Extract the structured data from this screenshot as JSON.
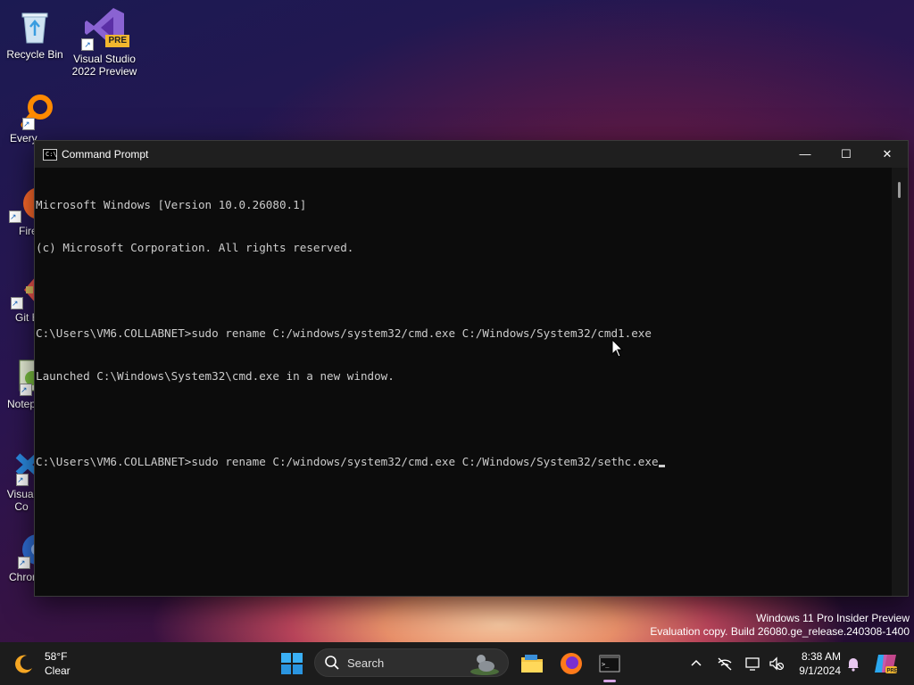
{
  "desktop": {
    "icons": [
      {
        "label": "Recycle Bin"
      },
      {
        "label": "Visual Studio\n2022 Preview",
        "badge": "PRE"
      },
      {
        "label": "Every"
      },
      {
        "label": "Fire"
      },
      {
        "label": "Git B"
      },
      {
        "label": "Notep"
      },
      {
        "label": "Visual\nCo"
      },
      {
        "label": "Chrom"
      }
    ]
  },
  "window": {
    "title": "Command Prompt",
    "icon_text": "C:\\",
    "controls": {
      "minimize": "—",
      "maximize": "☐",
      "close": "✕"
    },
    "console_lines": [
      "Microsoft Windows [Version 10.0.26080.1]",
      "(c) Microsoft Corporation. All rights reserved.",
      "",
      "C:\\Users\\VM6.COLLABNET>sudo rename C:/windows/system32/cmd.exe C:/Windows/System32/cmd1.exe",
      "Launched C:\\Windows\\System32\\cmd.exe in a new window.",
      "",
      "C:\\Users\\VM6.COLLABNET>sudo rename C:/windows/system32/cmd.exe C:/Windows/System32/sethc.exe"
    ]
  },
  "watermark": {
    "line1": "Windows 11 Pro Insider Preview",
    "line2": "Evaluation copy. Build 26080.ge_release.240308-1400"
  },
  "taskbar": {
    "weather": {
      "temp": "58°F",
      "condition": "Clear"
    },
    "search": {
      "label": "Search"
    },
    "clock": {
      "time": "8:38 AM",
      "date": "9/1/2024"
    },
    "tray_icons": [
      "chevron-up-icon",
      "network-off-icon",
      "display-icon",
      "volume-muted-icon",
      "notification-bell-icon",
      "copilot-icon"
    ]
  },
  "colors": {
    "console_bg": "#0c0c0c",
    "console_text": "#cccccc",
    "taskbar_bg": "#1c1c1c",
    "accent": "#0078d4"
  }
}
